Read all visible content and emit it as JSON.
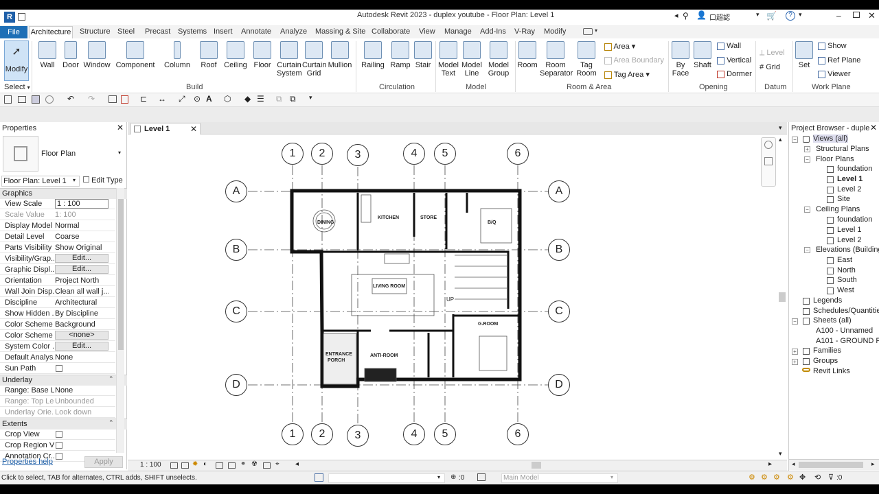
{
  "title": "Autodesk Revit 2023 - duplex youtube - Floor Plan: Level 1",
  "user": "口超認",
  "menu": {
    "file": "File",
    "tabs": [
      "Architecture",
      "Structure",
      "Steel",
      "Precast",
      "Systems",
      "Insert",
      "Annotate",
      "Analyze",
      "Massing & Site",
      "Collaborate",
      "View",
      "Manage",
      "Add-Ins",
      "V-Ray",
      "Modify"
    ]
  },
  "ribbon": {
    "modify": "Modify",
    "select": "Select",
    "build": [
      "Wall",
      "Door",
      "Window",
      "Component",
      "Column",
      "Roof",
      "Ceiling",
      "Floor"
    ],
    "curtain_system": [
      "Curtain",
      "System"
    ],
    "curtain_grid": [
      "Curtain",
      "Grid"
    ],
    "mullion": "Mullion",
    "circulation": [
      "Railing",
      "Ramp",
      "Stair"
    ],
    "model_text": [
      "Model",
      "Text"
    ],
    "model_line": [
      "Model",
      "Line"
    ],
    "model_group": [
      "Model",
      "Group"
    ],
    "room": "Room",
    "room_sep": [
      "Room",
      "Separator"
    ],
    "tag_room": [
      "Tag",
      "Room"
    ],
    "area": "Area",
    "area_boundary": "Area Boundary",
    "tag_area": "Tag Area",
    "by_face": [
      "By",
      "Face"
    ],
    "shaft": "Shaft",
    "wall_small": "Wall",
    "vertical": "Vertical",
    "dormer": "Dormer",
    "level": "Level",
    "grid": "Grid",
    "set": "Set",
    "show": "Show",
    "ref_plane": "Ref Plane",
    "viewer": "Viewer",
    "panels": [
      "Build",
      "Circulation",
      "Model",
      "Room & Area",
      "Opening",
      "Datum",
      "Work Plane"
    ]
  },
  "properties": {
    "title": "Properties",
    "type_name": "Floor Plan",
    "instance": "Floor Plan: Level 1",
    "edit_type": "Edit Type",
    "sections": [
      "Graphics",
      "Underlay",
      "Extents"
    ],
    "graphics": [
      {
        "k": "View Scale",
        "v": "1 : 100"
      },
      {
        "k": "Scale Value",
        "v": "1:  100"
      },
      {
        "k": "Display Model",
        "v": "Normal"
      },
      {
        "k": "Detail Level",
        "v": "Coarse"
      },
      {
        "k": "Parts Visibility",
        "v": "Show Original"
      },
      {
        "k": "Visibility/Grap...",
        "v": "Edit..."
      },
      {
        "k": "Graphic Displ...",
        "v": "Edit..."
      },
      {
        "k": "Orientation",
        "v": "Project North"
      },
      {
        "k": "Wall Join Disp...",
        "v": "Clean all wall j..."
      },
      {
        "k": "Discipline",
        "v": "Architectural"
      },
      {
        "k": "Show Hidden ...",
        "v": "By Discipline"
      },
      {
        "k": "Color Scheme ...",
        "v": "Background"
      },
      {
        "k": "Color Scheme",
        "v": "<none>"
      },
      {
        "k": "System Color ...",
        "v": "Edit..."
      },
      {
        "k": "Default Analys...",
        "v": "None"
      },
      {
        "k": "Sun Path",
        "v": ""
      }
    ],
    "underlay": [
      {
        "k": "Range: Base L...",
        "v": "None"
      },
      {
        "k": "Range: Top Le...",
        "v": "Unbounded"
      },
      {
        "k": "Underlay Orie...",
        "v": "Look down"
      }
    ],
    "extents": [
      {
        "k": "Crop View",
        "v": ""
      },
      {
        "k": "Crop Region V...",
        "v": ""
      },
      {
        "k": "Annotation Cr...",
        "v": ""
      }
    ],
    "help": "Properties help",
    "apply": "Apply"
  },
  "view": {
    "tab": "Level 1",
    "scale": "1 : 100",
    "grid_numbers": [
      "1",
      "2",
      "3",
      "4",
      "5",
      "6"
    ],
    "grid_letters": [
      "A",
      "B",
      "C",
      "D"
    ],
    "rooms": {
      "dining": "DINING",
      "kitchen": "KITCHEN",
      "store": "STORE",
      "bq": "B/Q",
      "living": "LIVING ROOM",
      "up": "UP",
      "groom": "G.ROOM",
      "entrance1": "ENTRANCE",
      "entrance2": "PORCH",
      "antiroom": "ANTI-ROOM"
    }
  },
  "browser": {
    "title": "Project Browser - duple...",
    "views_all": "Views (all)",
    "structural": "Structural Plans",
    "floor_plans": "Floor Plans",
    "fp_items": [
      "foundation",
      "Level 1",
      "Level 2",
      "Site"
    ],
    "ceiling": "Ceiling Plans",
    "cp_items": [
      "foundation",
      "Level 1",
      "Level 2"
    ],
    "elevations": "Elevations (Building",
    "el_items": [
      "East",
      "North",
      "South",
      "West"
    ],
    "legends": "Legends",
    "schedules": "Schedules/Quantities",
    "sheets": "Sheets (all)",
    "sheet_items": [
      "A100 - Unnamed",
      "A101 - GROUND FLC"
    ],
    "families": "Families",
    "groups": "Groups",
    "links": "Revit Links"
  },
  "status": {
    "text": "Click to select, TAB for alternates, CTRL adds, SHIFT unselects.",
    "zero": ":0",
    "model": "Main Model",
    "filter": ":0"
  },
  "colors": {
    "file_blue": "#1e6fb6",
    "accent": "#4a90d9"
  }
}
